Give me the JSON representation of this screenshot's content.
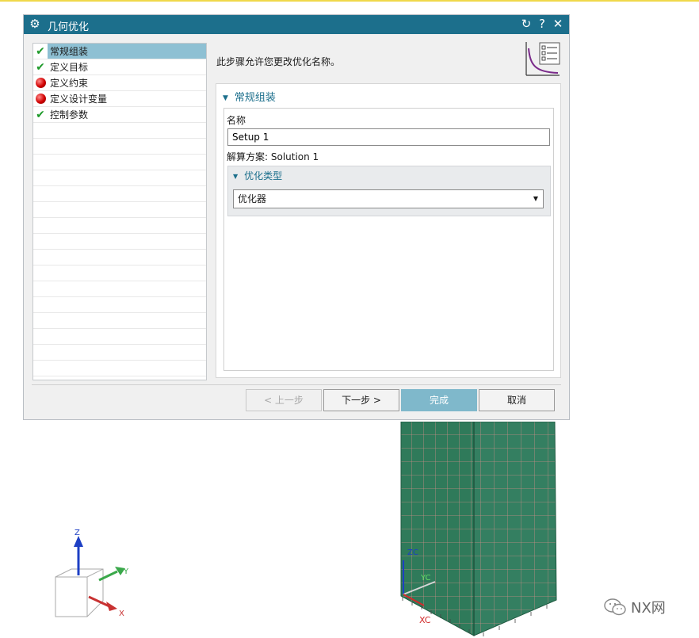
{
  "dialog": {
    "title": "几何优化",
    "title_icon": "gear-icon",
    "controls": {
      "reset_icon": "refresh-icon",
      "help": "?",
      "close": "✕"
    },
    "description": "此步骤允许您更改优化名称。",
    "steps": [
      {
        "label": "常规组装",
        "status": "complete",
        "selected": true
      },
      {
        "label": "定义目标",
        "status": "complete",
        "selected": false
      },
      {
        "label": "定义约束",
        "status": "incomplete",
        "selected": false
      },
      {
        "label": "定义设计变量",
        "status": "incomplete",
        "selected": false
      },
      {
        "label": "控制参数",
        "status": "complete",
        "selected": false
      }
    ],
    "group": {
      "title": "常规组装",
      "name_label": "名称",
      "name_value": "Setup 1",
      "solution_label": "解算方案: Solution 1",
      "subgroup": {
        "title": "优化类型",
        "selected": "优化器"
      }
    },
    "buttons": {
      "back": "< 上一步",
      "next": "下一步 >",
      "finish": "完成",
      "cancel": "取消"
    }
  },
  "viewport": {
    "triad": {
      "z": "Z",
      "y": "Y",
      "x": "X"
    },
    "wcs": {
      "zc": "ZC",
      "yc": "YC",
      "xc": "XC"
    },
    "mesh_color": "#2f7a5a"
  },
  "watermark": "NX网"
}
